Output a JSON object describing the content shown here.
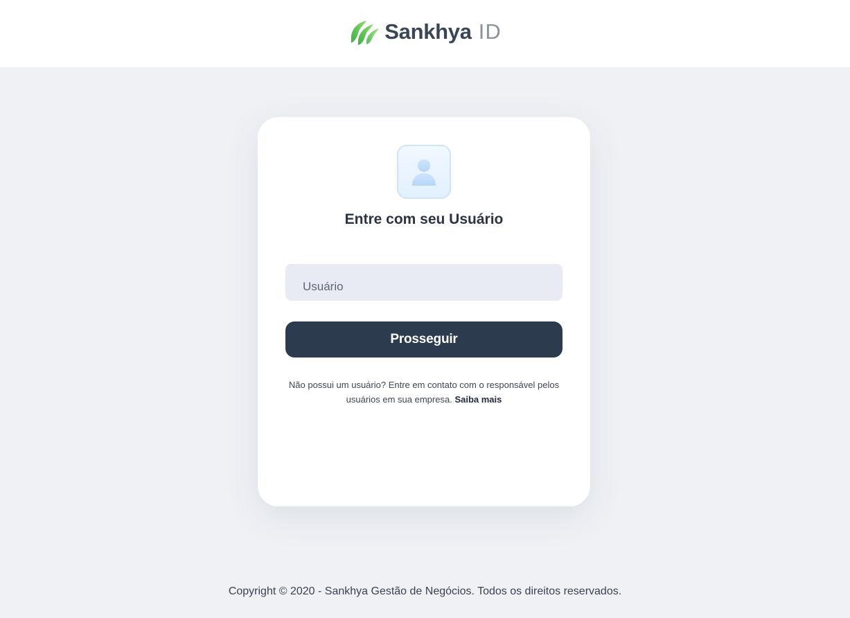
{
  "brand": {
    "name": "Sankhya",
    "suffix": "ID",
    "accent_green": "#5cc15a",
    "dark": "#3a4656"
  },
  "login": {
    "avatar_icon": "user-avatar-icon",
    "heading": "Entre com seu Usuário",
    "username": {
      "placeholder": "Usuário",
      "value": ""
    },
    "submit_label": "Prosseguir",
    "help_text": "Não possui um usuário? Entre em contato com o responsável pelos usuários em sua empresa.",
    "help_link": "Saiba mais"
  },
  "footer": {
    "copyright": "Copyright © 2020 - Sankhya Gestão de Negócios. Todos os direitos reservados."
  },
  "colors": {
    "page_bg": "#eff1f5",
    "card_bg": "#ffffff",
    "input_bg": "#e8ebf4",
    "button_bg": "#2d3b4f"
  }
}
